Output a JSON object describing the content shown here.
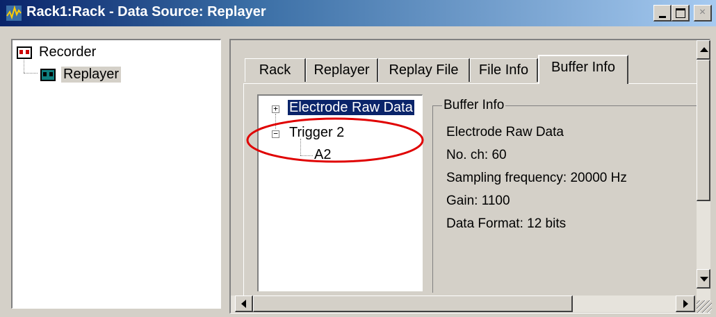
{
  "window": {
    "title": "Rack1:Rack - Data Source: Replayer",
    "close_glyph": "×"
  },
  "left_tree": {
    "items": [
      {
        "label": "Recorder",
        "icon": "recorder-device-icon"
      },
      {
        "label": "Replayer",
        "icon": "replayer-device-icon",
        "selected": true
      }
    ]
  },
  "tabs": [
    {
      "label": "Rack"
    },
    {
      "label": "Replayer"
    },
    {
      "label": "Replay File"
    },
    {
      "label": "File Info"
    },
    {
      "label": "Buffer Info",
      "active": true
    }
  ],
  "buffer_tree": {
    "items": [
      {
        "label": "Electrode Raw Data",
        "expander": "+",
        "selected": true
      },
      {
        "label": "Trigger 2",
        "expander": "−"
      },
      {
        "label": "A2"
      }
    ]
  },
  "buffer_info": {
    "title": "Buffer Info",
    "lines": [
      "Electrode Raw Data",
      "No. ch: 60",
      "Sampling frequency: 20000 Hz",
      "Gain: 1100",
      "Data Format: 12 bits"
    ]
  },
  "colors": {
    "title_bar_start": "#0a246a",
    "title_bar_end": "#a6caf0",
    "face": "#d4d0c8",
    "selection": "#0a246a",
    "annotation_ellipse": "#e00000"
  }
}
